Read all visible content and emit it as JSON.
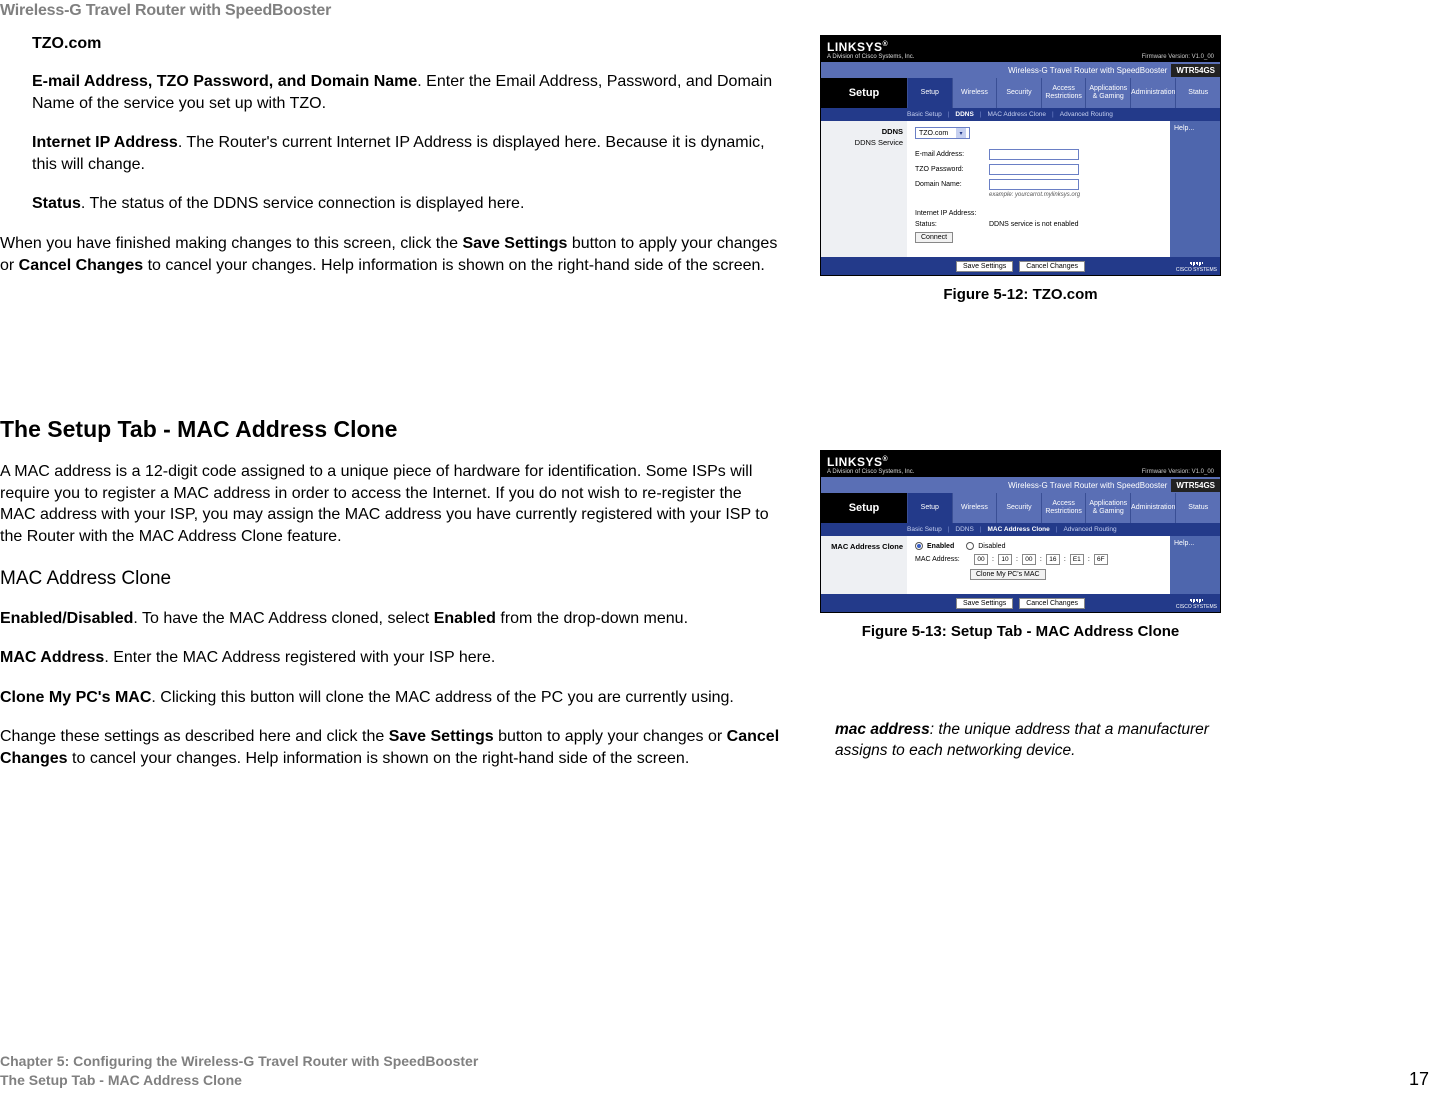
{
  "header": "Wireless-G Travel Router with SpeedBooster",
  "tzo": {
    "title": "TZO.com",
    "p1_bold": "E-mail Address, TZO Password, and Domain Name",
    "p1_rest": ". Enter the Email Address, Password, and Domain Name of the service you set up with TZO.",
    "p2_bold": "Internet IP Address",
    "p2_rest": ". The Router's current Internet IP Address is displayed here. Because it is dynamic, this will change.",
    "p3_bold": "Status",
    "p3_rest": ". The status of the DDNS service connection is displayed here."
  },
  "save_para_1a": "When you have finished making changes to this screen, click the ",
  "save_para_1b": "Save Settings",
  "save_para_1c": " button to apply your changes or ",
  "save_para_1d": "Cancel Changes",
  "save_para_1e": " to cancel your changes. Help information is shown on the right-hand side of the screen.",
  "mac": {
    "h2": "The Setup Tab - MAC Address Clone",
    "intro": "A MAC address is a 12-digit code assigned to a unique piece of hardware for identification. Some ISPs will require you to register a MAC address in order to access the Internet.  If you do not wish to re-register the MAC address with your ISP, you may assign the MAC address you have currently registered with your ISP to the Router with the MAC Address Clone feature.",
    "sub": "MAC Address Clone",
    "p1_bold": "Enabled/Disabled",
    "p1_rest": ". To have the MAC Address cloned, select ",
    "p1_bold2": "Enabled",
    "p1_rest2": " from the drop-down menu.",
    "p2_bold": "MAC Address",
    "p2_rest": ". Enter the MAC Address registered with your ISP here.",
    "p3_bold": "Clone My PC's MAC",
    "p3_rest": ". Clicking this button will clone the MAC address of the PC you are currently using."
  },
  "save_para_2a": "Change these settings as described here and click the ",
  "save_para_2b": "Save Settings",
  "save_para_2c": " button to apply your changes or ",
  "save_para_2d": "Cancel Changes",
  "save_para_2e": " to cancel your changes. Help information is shown on the right-hand side of the screen.",
  "fig1_caption": "Figure 5-12: TZO.com",
  "fig2_caption": "Figure 5-13: Setup Tab - MAC Address Clone",
  "glossary_term": "mac address",
  "glossary_def": ": the unique address that a manufacturer assigns to each networking device.",
  "footer": {
    "line1": "Chapter 5: Configuring the Wireless-G Travel Router with SpeedBooster",
    "line2": "The Setup Tab - MAC Address Clone",
    "page": "17"
  },
  "ui": {
    "logo_word": "LINKSYS",
    "logo_sub": "A Division of Cisco Systems, Inc.",
    "firmware": "Firmware Version: V1.0_00",
    "product": "Wireless-G Travel Router with SpeedBooster",
    "model": "WTR54GS",
    "bigtab": "Setup",
    "tabs": [
      "Setup",
      "Wireless",
      "Security",
      "Access\nRestrictions",
      "Applications &\nGaming",
      "Administration",
      "Status"
    ],
    "subnav": [
      "Basic Setup",
      "DDNS",
      "MAC Address Clone",
      "Advanced Routing"
    ],
    "help": "Help...",
    "save": "Save Settings",
    "cancel": "Cancel Changes",
    "cisco": "CISCO SYSTEMS",
    "tzo_panel": {
      "left_label": "DDNS",
      "left_sub": "DDNS Service",
      "select_val": "TZO.com",
      "rows": [
        "E-mail Address:",
        "TZO Password:",
        "Domain Name:"
      ],
      "example": "example: yourcarrot.mylinksys.org",
      "ip_label": "Internet IP Address:",
      "status_label": "Status:",
      "status_val": "DDNS service is not enabled",
      "connect": "Connect"
    },
    "mac_panel": {
      "left_label": "MAC Address Clone",
      "enabled": "Enabled",
      "disabled": "Disabled",
      "mac_label": "MAC Address:",
      "mac_val": [
        "00",
        "10",
        "00",
        "16",
        "E1",
        "6F"
      ],
      "clone_btn": "Clone My PC's MAC"
    }
  }
}
